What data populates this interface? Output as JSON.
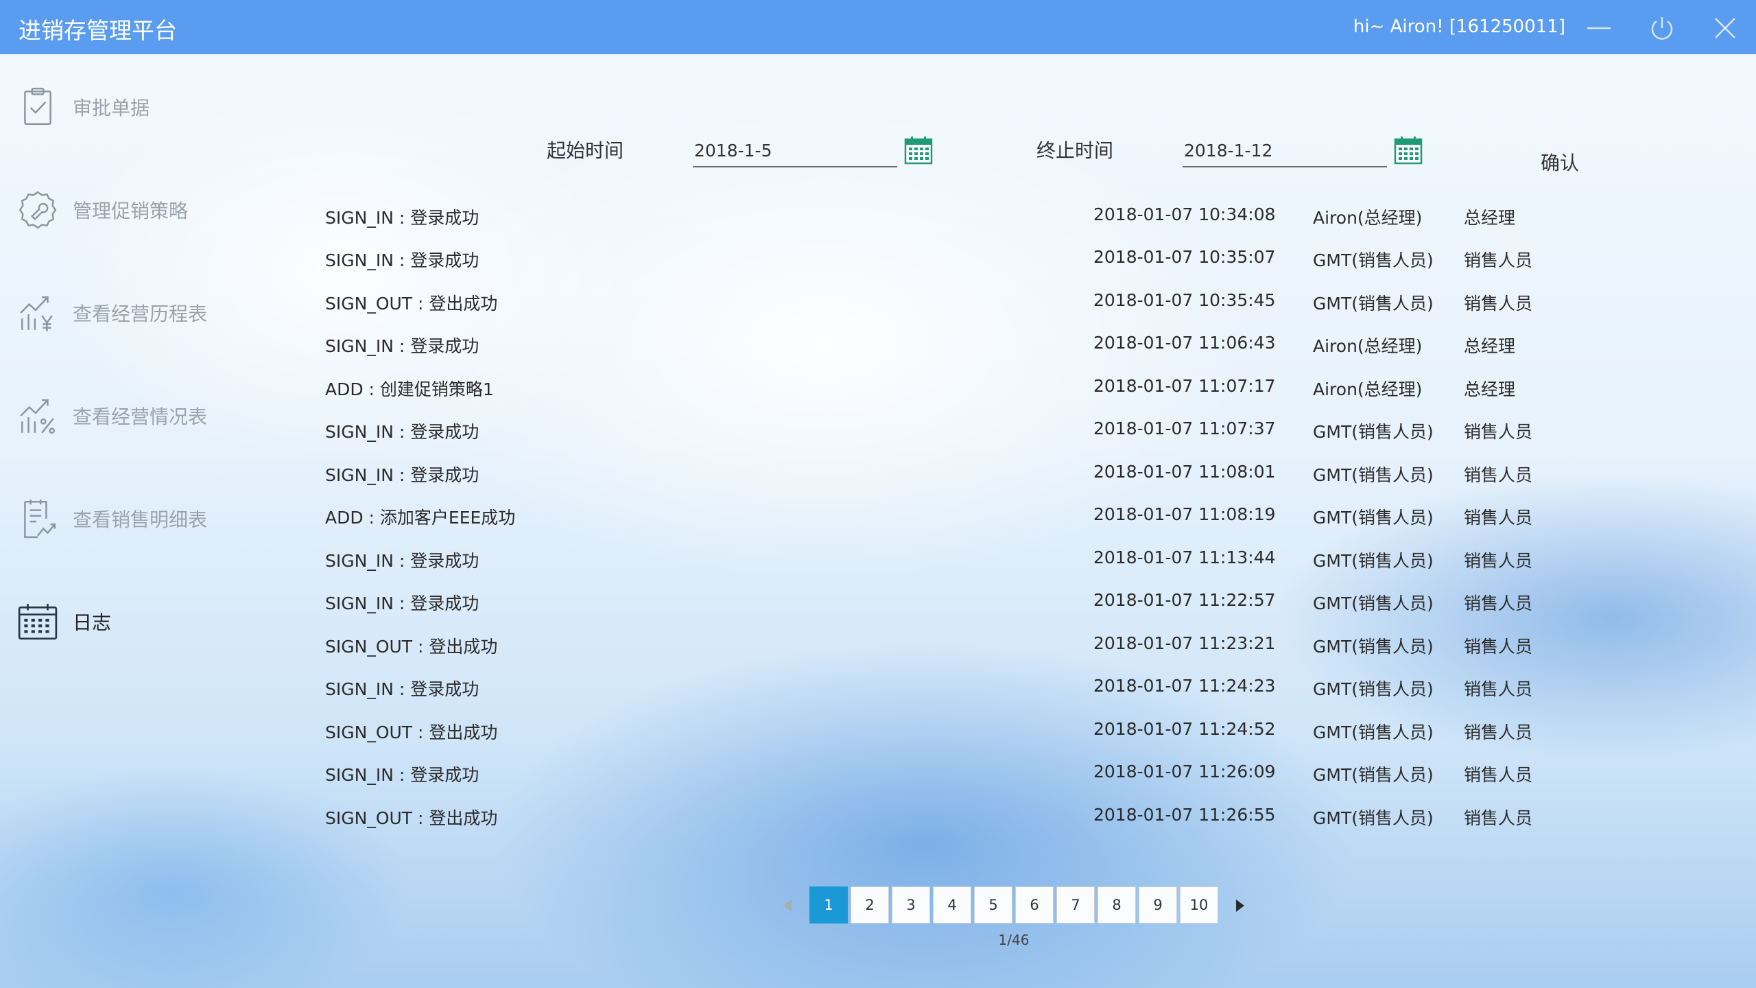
{
  "window": {
    "title": "进销存管理平台",
    "user_text": "hi~ Airon! [161250011]"
  },
  "sidebar": {
    "items": [
      {
        "label": "审批单据",
        "icon": "clipboard-check-icon",
        "active": false
      },
      {
        "label": "管理促销策略",
        "icon": "gear-wrench-icon",
        "active": false
      },
      {
        "label": "查看经营历程表",
        "icon": "chart-yen-icon",
        "active": false
      },
      {
        "label": "查看经营情况表",
        "icon": "chart-percent-icon",
        "active": false
      },
      {
        "label": "查看销售明细表",
        "icon": "document-chart-icon",
        "active": false
      },
      {
        "label": "日志",
        "icon": "calendar-icon",
        "active": true
      }
    ]
  },
  "filter": {
    "start_label": "起始时间",
    "start_value": "2018-1-5",
    "end_label": "终止时间",
    "end_value": "2018-1-12",
    "confirm_label": "确认"
  },
  "logs": [
    {
      "event": "SIGN_IN : 登录成功",
      "time": "2018-01-07 10:34:08",
      "user": "Airon(总经理)",
      "role": "总经理"
    },
    {
      "event": "SIGN_IN : 登录成功",
      "time": "2018-01-07 10:35:07",
      "user": "GMT(销售人员)",
      "role": "销售人员"
    },
    {
      "event": "SIGN_OUT : 登出成功",
      "time": "2018-01-07 10:35:45",
      "user": "GMT(销售人员)",
      "role": "销售人员"
    },
    {
      "event": "SIGN_IN : 登录成功",
      "time": "2018-01-07 11:06:43",
      "user": "Airon(总经理)",
      "role": "总经理"
    },
    {
      "event": "ADD : 创建促销策略1",
      "time": "2018-01-07 11:07:17",
      "user": "Airon(总经理)",
      "role": "总经理"
    },
    {
      "event": "SIGN_IN : 登录成功",
      "time": "2018-01-07 11:07:37",
      "user": "GMT(销售人员)",
      "role": "销售人员"
    },
    {
      "event": "SIGN_IN : 登录成功",
      "time": "2018-01-07 11:08:01",
      "user": "GMT(销售人员)",
      "role": "销售人员"
    },
    {
      "event": "ADD : 添加客户EEE成功",
      "time": "2018-01-07 11:08:19",
      "user": "GMT(销售人员)",
      "role": "销售人员"
    },
    {
      "event": "SIGN_IN : 登录成功",
      "time": "2018-01-07 11:13:44",
      "user": "GMT(销售人员)",
      "role": "销售人员"
    },
    {
      "event": "SIGN_IN : 登录成功",
      "time": "2018-01-07 11:22:57",
      "user": "GMT(销售人员)",
      "role": "销售人员"
    },
    {
      "event": "SIGN_OUT : 登出成功",
      "time": "2018-01-07 11:23:21",
      "user": "GMT(销售人员)",
      "role": "销售人员"
    },
    {
      "event": "SIGN_IN : 登录成功",
      "time": "2018-01-07 11:24:23",
      "user": "GMT(销售人员)",
      "role": "销售人员"
    },
    {
      "event": "SIGN_OUT : 登出成功",
      "time": "2018-01-07 11:24:52",
      "user": "GMT(销售人员)",
      "role": "销售人员"
    },
    {
      "event": "SIGN_IN : 登录成功",
      "time": "2018-01-07 11:26:09",
      "user": "GMT(销售人员)",
      "role": "销售人员"
    },
    {
      "event": "SIGN_OUT : 登出成功",
      "time": "2018-01-07 11:26:55",
      "user": "GMT(销售人员)",
      "role": "销售人员"
    }
  ],
  "pagination": {
    "pages": [
      "1",
      "2",
      "3",
      "4",
      "5",
      "6",
      "7",
      "8",
      "9",
      "10"
    ],
    "current": "1",
    "indicator": "1/46"
  },
  "colors": {
    "titlebar": "#5a9df0",
    "active_page": "#1b98d6",
    "calendar_icon": "#1f9a7a"
  }
}
